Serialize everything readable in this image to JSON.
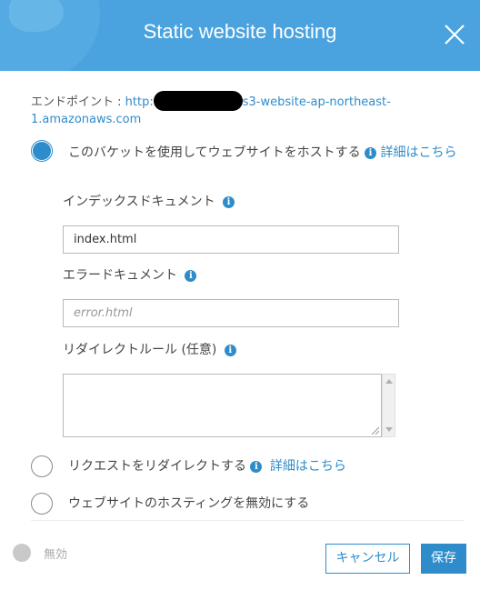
{
  "dialog": {
    "title": "Static website hosting"
  },
  "endpoint": {
    "label": "エンドポイント : ",
    "url_prefix": "http:",
    "url_suffix": "s3-website-ap-northeast-",
    "url_line2": "1.amazonaws.com"
  },
  "options": {
    "host": {
      "label": "このバケットを使用してウェブサイトをホストする",
      "detail_link": "詳細はこちら",
      "selected": true
    },
    "redirect": {
      "label": "リクエストをリダイレクトする",
      "detail_link": "詳細はこちら",
      "selected": false
    },
    "disable": {
      "label": "ウェブサイトのホスティングを無効にする",
      "selected": false
    }
  },
  "fields": {
    "index_label": "インデックスドキュメント",
    "index_value": "index.html",
    "error_label": "エラードキュメント",
    "error_placeholder": "error.html",
    "redirect_rules_label": "リダイレクトルール (任意)"
  },
  "footer": {
    "toggle_label": "無効",
    "cancel_label": "キャンセル",
    "save_label": "保存"
  },
  "colors": {
    "header": "#4aa3df",
    "accent": "#2e8ccb"
  },
  "icons": {
    "close": "close-icon",
    "info": "info-icon"
  }
}
